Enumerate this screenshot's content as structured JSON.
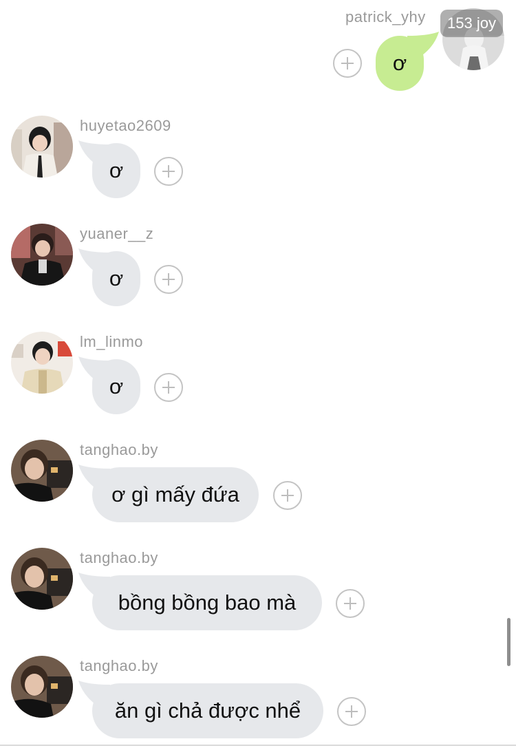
{
  "theme": {
    "bubble_other": "#e6e8eb",
    "bubble_mine": "#c7ec92",
    "username_color": "#9a9a9a"
  },
  "badge": {
    "text": "153 joy"
  },
  "messages": [
    {
      "user": "patrick_yhy",
      "text": "ơ",
      "mine": true,
      "react_icon": "plus-icon"
    },
    {
      "user": "huyetao2609",
      "text": "ơ",
      "mine": false,
      "react_icon": "plus-icon"
    },
    {
      "user": "yuaner__z",
      "text": "ơ",
      "mine": false,
      "react_icon": "plus-icon"
    },
    {
      "user": "lm_linmo",
      "text": "ơ",
      "mine": false,
      "react_icon": "plus-icon"
    },
    {
      "user": "tanghao.by",
      "text": "ơ gì mấy đứa",
      "mine": false,
      "react_icon": "plus-icon"
    },
    {
      "user": "tanghao.by",
      "text": "bồng bồng bao mà",
      "mine": false,
      "react_icon": "plus-icon"
    },
    {
      "user": "tanghao.by",
      "text": "ăn gì chả được nhể",
      "mine": false,
      "react_icon": "plus-icon"
    }
  ]
}
